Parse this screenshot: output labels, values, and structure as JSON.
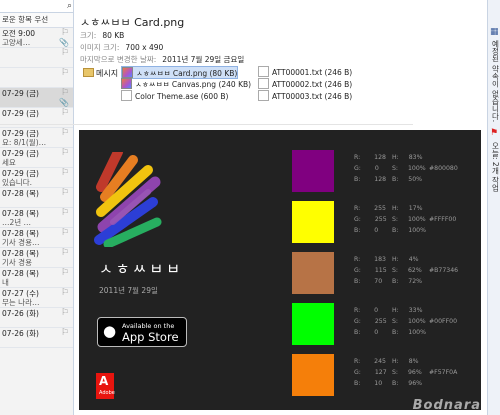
{
  "mail_list": {
    "sort_label": "로운 항목 우선",
    "items": [
      {
        "date": "오전 9:00",
        "snippet": "고양세…",
        "icon": "flag-outline-icon",
        "icon2": "attachment-icon",
        "selected": false
      },
      {
        "date": "",
        "snippet": "",
        "icon": "flag-outline-icon",
        "icon2": "",
        "selected": false
      },
      {
        "date": "",
        "snippet": "",
        "icon": "flag-outline-icon",
        "icon2": "",
        "selected": false
      },
      {
        "date": "07-29 (금)",
        "snippet": "",
        "icon": "flag-outline-icon",
        "icon2": "attachment-icon",
        "selected": true
      },
      {
        "date": "07-29 (금)",
        "snippet": "",
        "icon": "flag-outline-icon",
        "icon2": "",
        "selected": false
      },
      {
        "date": "07-29 (금)",
        "snippet": "요: 8/1(월)…",
        "icon": "flag-outline-icon",
        "icon2": "",
        "selected": false
      },
      {
        "date": "07-29 (금)",
        "snippet": "세요",
        "icon": "flag-outline-icon",
        "icon2": "",
        "selected": false
      },
      {
        "date": "07-29 (금)",
        "snippet": "있습니다.",
        "icon": "flag-outline-icon",
        "icon2": "",
        "selected": false
      },
      {
        "date": "07-28 (목)",
        "snippet": "",
        "icon": "flag-outline-icon",
        "icon2": "",
        "selected": false
      },
      {
        "date": "07-28 (목)",
        "snippet": "…2년 …",
        "icon": "flag-outline-icon",
        "icon2": "",
        "selected": false
      },
      {
        "date": "07-28 (목)",
        "snippet": "기사 경용…",
        "icon": "flag-outline-icon",
        "icon2": "",
        "selected": false
      },
      {
        "date": "07-28 (목)",
        "snippet": "기사 경용",
        "icon": "flag-outline-icon",
        "icon2": "",
        "selected": false
      },
      {
        "date": "07-28 (목)",
        "snippet": "내",
        "icon": "flag-outline-icon",
        "icon2": "",
        "selected": false
      },
      {
        "date": "07-27 (수)",
        "snippet": "무는 나라…",
        "icon": "flag-outline-icon",
        "icon2": "",
        "selected": false
      },
      {
        "date": "07-26 (화)",
        "snippet": "",
        "icon": "flag-outline-icon",
        "icon2": "",
        "selected": false
      },
      {
        "date": "07-26 (화)",
        "snippet": "",
        "icon": "flag-outline-icon",
        "icon2": "",
        "selected": false
      }
    ]
  },
  "right_panel": {
    "appointments_label": "예정된 약속이 없습니다.",
    "tasks_label": "오늘: 2개 작업"
  },
  "message": {
    "title": "ㅅㅎㅆㅂㅂ Card.png",
    "size_label": "크기:",
    "size_value": "80 KB",
    "dims_label": "이미지 크기:",
    "dims_value": "700 x 490",
    "modified_label": "마지막으로 변경한 날짜:",
    "modified_value": "2011년 7월 29일 금요일",
    "message_label": "메시지",
    "attachments": [
      {
        "name": "ㅅㅎㅆㅂㅂ Card.png (80 KB)",
        "type": "png",
        "selected": true
      },
      {
        "name": "ㅅㅎㅆㅂㅂ Canvas.png (240 KB)",
        "type": "png",
        "selected": false
      },
      {
        "name": "Color Theme.ase (600 B)",
        "type": "file",
        "selected": false
      },
      {
        "name": "ATT00001.txt (246 B)",
        "type": "txt",
        "selected": false
      },
      {
        "name": "ATT00002.txt (246 B)",
        "type": "txt",
        "selected": false
      },
      {
        "name": "ATT00003.txt (246 B)",
        "type": "txt",
        "selected": false
      }
    ]
  },
  "card": {
    "brand": "ㅅㅎㅆㅂㅂ",
    "date": "2011년 7월 29일",
    "appstore_line1": "Available on the",
    "appstore_line2": "App Store",
    "adobe_text": "Adobe",
    "swatches": [
      {
        "color": "#800080",
        "r": "128",
        "g": "0",
        "b": "128",
        "h": "83%",
        "s": "100%",
        "bv": "50%",
        "hex": "#800080"
      },
      {
        "color": "#FFFF00",
        "r": "255",
        "g": "255",
        "b": "0",
        "h": "17%",
        "s": "100%",
        "bv": "100%",
        "hex": "#FFFF00"
      },
      {
        "color": "#B77346",
        "r": "183",
        "g": "115",
        "b": "70",
        "h": "4%",
        "s": "62%",
        "bv": "72%",
        "hex": "#B77346"
      },
      {
        "color": "#00FF00",
        "r": "0",
        "g": "255",
        "b": "0",
        "h": "33%",
        "s": "100%",
        "bv": "100%",
        "hex": "#00FF00"
      },
      {
        "color": "#F57F0A",
        "r": "245",
        "g": "127",
        "b": "10",
        "h": "8%",
        "s": "96%",
        "bv": "96%",
        "hex": "#F57F0A"
      }
    ]
  },
  "watermark": "Bodnara"
}
